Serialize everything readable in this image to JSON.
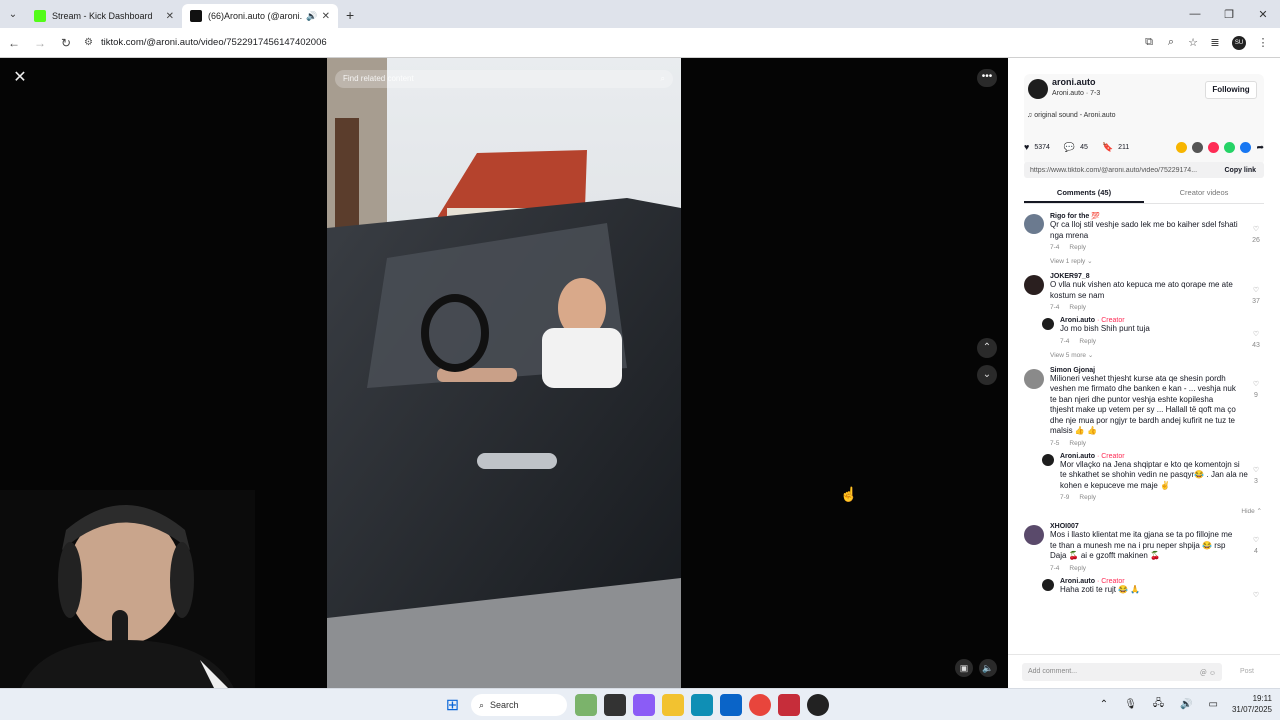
{
  "browser": {
    "tabs": [
      {
        "title": "Stream - Kick Dashboard",
        "favicon_color": "#53fc18",
        "active": false
      },
      {
        "title": "(66)Aroni.auto (@aroni.auto",
        "favicon_color": "#111111",
        "active": true
      }
    ],
    "url": "tiktok.com/@aroni.auto/video/7522917456147402006",
    "profile_label": "SU"
  },
  "video": {
    "search_placeholder": "Find related content"
  },
  "panel": {
    "author": {
      "username": "aroni.auto",
      "subtitle": "Aroni.auto · 7-3",
      "follow_label": "Following",
      "sound": "original sound - Aroni.auto"
    },
    "stats": {
      "likes": "5374",
      "comments": "45",
      "saves": "211"
    },
    "share_colors": [
      "#f7b500",
      "#555555",
      "#fe2c55",
      "#25d366",
      "#1877f2"
    ],
    "link": "https://www.tiktok.com/@aroni.auto/video/75229174...",
    "copy_label": "Copy link",
    "tabs": [
      "Comments (45)",
      "Creator videos"
    ],
    "comments": [
      {
        "user": "Rigo for the 💯",
        "text": "Qr ca lloj stil veshje sado lek me bo kaiher sdel fshati nga mrena",
        "date": "7-4",
        "reply": "Reply",
        "likes": "26",
        "more": "View 1 reply ⌄"
      },
      {
        "user": "JOKER97_8",
        "text": "O vlla nuk vishen ato kepuca me ato qorape me ate kostum se nam",
        "date": "7-4",
        "reply": "Reply",
        "likes": "37"
      },
      {
        "user": "Aroni.auto",
        "creator": "· Creator",
        "text": "Jo mo bish Shih punt tuja",
        "date": "7-4",
        "reply": "Reply",
        "likes": "43",
        "more": "View 5 more ⌄"
      },
      {
        "user": "Simon Gjonaj",
        "text": "Milioneri veshet thjesht kurse ata qe shesin pordh veshen me firmato dhe banken e kan - ... veshja nuk te ban njeri dhe puntor veshja eshte kopilesha thjesht make up vetem per sy ... Hallall të qoft ma ço dhe nje mua por ngjyr te bardh andej kufirit ne tuz te malsis 👍 👍",
        "date": "7-5",
        "reply": "Reply",
        "likes": "9"
      },
      {
        "user": "Aroni.auto",
        "creator": "· Creator",
        "text": "Mor vllaçko na Jena shqiptar e kto qe komentojn si te shkathet se shohin vedin ne pasqyr😂 . Jan ala ne kohen e kepuceve me maje ✌️",
        "date": "7-9",
        "reply": "Reply",
        "likes": "3",
        "hide": "Hide ⌃"
      },
      {
        "user": "XHOI007",
        "text": "Mos i llasto klientat me ita gjana se ta po fillojne me te than a munesh me na i pru neper shpija 😂 rsp Daja 🍒 ai e gzofft makinen 🍒",
        "date": "7-4",
        "reply": "Reply",
        "likes": "4"
      },
      {
        "user": "Aroni.auto",
        "creator": "· Creator",
        "text": "Haha zoti te rujt 😂 🙏",
        "date": "",
        "reply": "",
        "likes": ""
      }
    ],
    "compose_placeholder": "Add comment...",
    "post_label": "Post"
  },
  "taskbar": {
    "search_label": "Search",
    "time": "19:11",
    "date": "31/07/2025"
  }
}
